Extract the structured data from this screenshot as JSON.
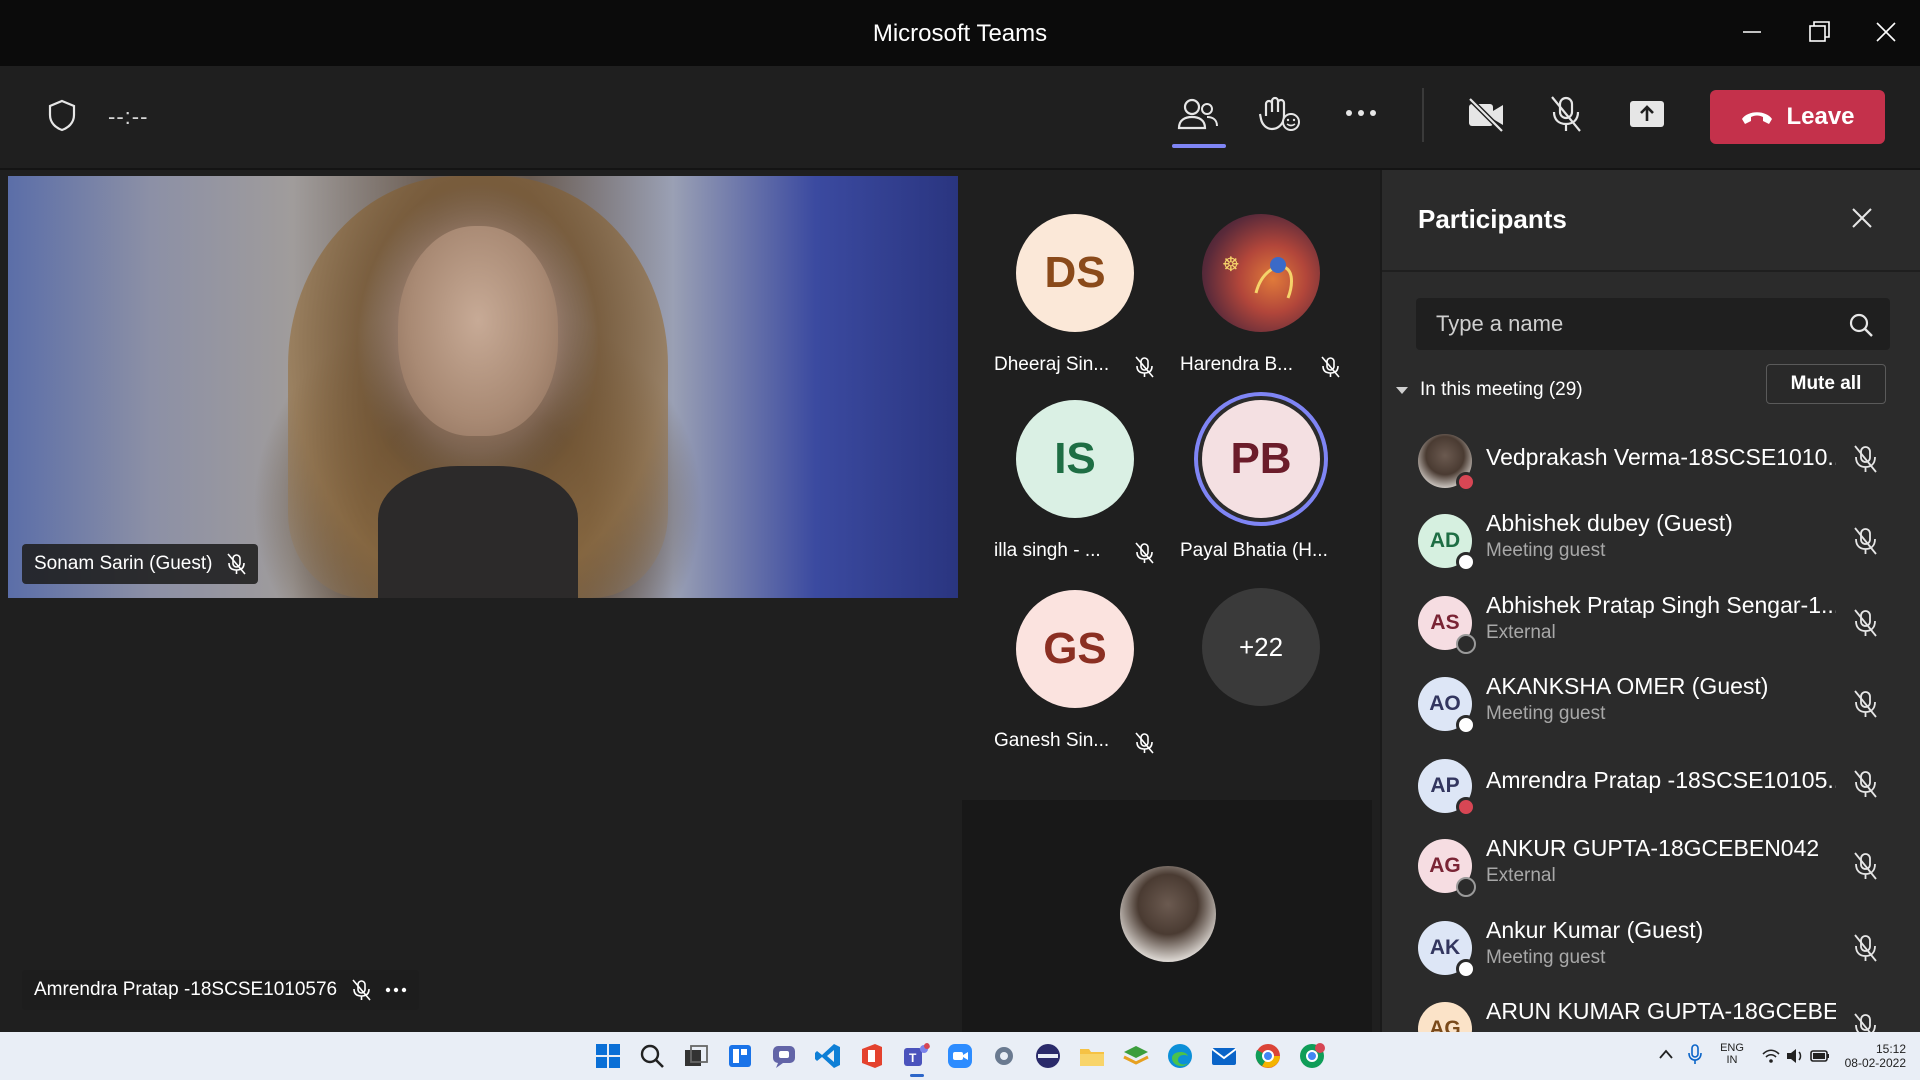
{
  "window": {
    "title": "Microsoft Teams"
  },
  "toolbar": {
    "timer": "--:--",
    "leave_label": "Leave"
  },
  "main_video": {
    "name": "Sonam Sarin (Guest)"
  },
  "tiles": [
    {
      "initials": "DS",
      "name": "Dheeraj Sin...",
      "bg": "#fbe8d8",
      "fg": "#8a4a1a"
    },
    {
      "initials": "",
      "name": "Harendra B...",
      "bg": "#8a3a2a",
      "fg": "#ffffff"
    },
    {
      "initials": "IS",
      "name": "illa singh - ...",
      "bg": "#daf0e4",
      "fg": "#1e6e44"
    },
    {
      "initials": "PB",
      "name": "Payal Bhatia (H...",
      "bg": "#f4e0e2",
      "fg": "#6b1c2a"
    },
    {
      "initials": "GS",
      "name": "Ganesh Sin...",
      "bg": "#fbe3df",
      "fg": "#8b2f22"
    },
    {
      "overflow": "+22"
    }
  ],
  "self_view": {
    "name": "Amrendra Pratap -18SCSE1010576"
  },
  "panel": {
    "title": "Participants",
    "search_placeholder": "Type a name",
    "section_label": "In this meeting (29)",
    "mute_all_label": "Mute all",
    "participants": [
      {
        "initials": "",
        "name": "Vedprakash Verma-18SCSE1010...",
        "sub": "",
        "status": "busy",
        "avatar_bg": "#5a4a40"
      },
      {
        "initials": "AD",
        "name": "Abhishek dubey (Guest)",
        "sub": "Meeting guest",
        "status": "guest",
        "avatar_bg": "#d6f0e0"
      },
      {
        "initials": "AS",
        "name": "Abhishek Pratap Singh Sengar-1...",
        "sub": "External",
        "status": "external",
        "avatar_bg": "#f6dde2"
      },
      {
        "initials": "AO",
        "name": "AKANKSHA OMER (Guest)",
        "sub": "Meeting guest",
        "status": "guest",
        "avatar_bg": "#dde6f6"
      },
      {
        "initials": "AP",
        "name": "Amrendra Pratap -18SCSE10105...",
        "sub": "",
        "status": "busy",
        "avatar_bg": "#dde6f6"
      },
      {
        "initials": "AG",
        "name": "ANKUR GUPTA-18GCEBEN042",
        "sub": "External",
        "status": "external",
        "avatar_bg": "#f6dde2"
      },
      {
        "initials": "AK",
        "name": "Ankur Kumar (Guest)",
        "sub": "Meeting guest",
        "status": "guest",
        "avatar_bg": "#dde6f6"
      },
      {
        "initials": "AG",
        "name": "ARUN KUMAR GUPTA-18GCEBE...",
        "sub": "",
        "status": "",
        "avatar_bg": "#fbe3c8"
      }
    ]
  },
  "taskbar": {
    "lang_top": "ENG",
    "lang_bottom": "IN",
    "time": "15:12",
    "date": "08-02-2022",
    "apps": [
      "windows-start",
      "search",
      "task-view",
      "widgets",
      "chat",
      "vscode",
      "office",
      "teams",
      "zoom",
      "settings",
      "terminal",
      "file-explorer",
      "layers-app",
      "edge",
      "mail",
      "chrome",
      "chrome-profile"
    ]
  },
  "colors": {
    "accent": "#7f85f5",
    "leave": "#c4314b",
    "busy": "#d74654"
  }
}
